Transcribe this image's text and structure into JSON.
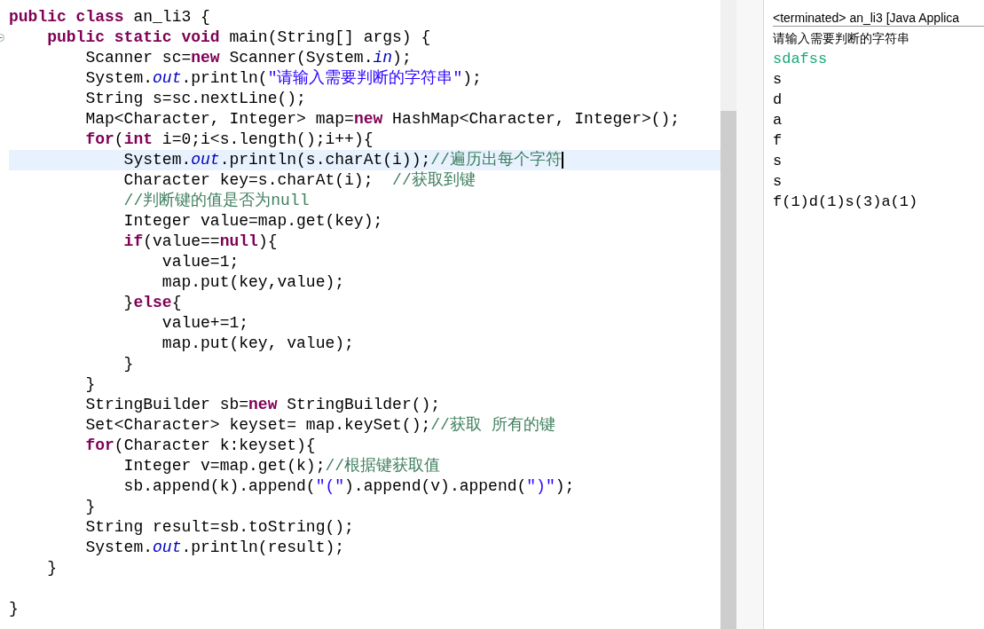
{
  "editor": {
    "lines": [
      {
        "current": false,
        "folded_marker": false,
        "tokens": [
          {
            "kind": "keyword",
            "text": "public class"
          },
          {
            "kind": "plain",
            "text": " an_li3 {"
          }
        ]
      },
      {
        "current": false,
        "folded_marker": true,
        "tokens": [
          {
            "kind": "keyword",
            "text": "    public static void"
          },
          {
            "kind": "plain",
            "text": " main(String[] args) {"
          }
        ]
      },
      {
        "current": false,
        "folded_marker": false,
        "tokens": [
          {
            "kind": "plain",
            "text": "        Scanner sc="
          },
          {
            "kind": "keyword",
            "text": "new"
          },
          {
            "kind": "plain",
            "text": " Scanner(System."
          },
          {
            "kind": "field",
            "text": "in"
          },
          {
            "kind": "plain",
            "text": ");"
          }
        ]
      },
      {
        "current": false,
        "folded_marker": false,
        "tokens": [
          {
            "kind": "plain",
            "text": "        System."
          },
          {
            "kind": "field",
            "text": "out"
          },
          {
            "kind": "plain",
            "text": ".println("
          },
          {
            "kind": "string",
            "text": "\"请输入需要判断的字符串\""
          },
          {
            "kind": "plain",
            "text": ");"
          }
        ]
      },
      {
        "current": false,
        "folded_marker": false,
        "tokens": [
          {
            "kind": "plain",
            "text": "        String s=sc.nextLine();"
          }
        ]
      },
      {
        "current": false,
        "folded_marker": false,
        "tokens": [
          {
            "kind": "plain",
            "text": "        Map<Character, Integer> map="
          },
          {
            "kind": "keyword",
            "text": "new"
          },
          {
            "kind": "plain",
            "text": " HashMap<Character, Integer>();"
          }
        ]
      },
      {
        "current": false,
        "folded_marker": false,
        "tokens": [
          {
            "kind": "keyword",
            "text": "        for"
          },
          {
            "kind": "plain",
            "text": "("
          },
          {
            "kind": "keyword",
            "text": "int"
          },
          {
            "kind": "plain",
            "text": " i=0;i<s.length();i++){"
          }
        ]
      },
      {
        "current": true,
        "folded_marker": false,
        "tokens": [
          {
            "kind": "plain",
            "text": "            System."
          },
          {
            "kind": "field",
            "text": "out"
          },
          {
            "kind": "plain",
            "text": ".println(s.charAt(i));"
          },
          {
            "kind": "comment",
            "text": "//遍历出每个字符"
          }
        ]
      },
      {
        "current": false,
        "folded_marker": false,
        "tokens": [
          {
            "kind": "plain",
            "text": "            Character key=s.charAt(i);  "
          },
          {
            "kind": "comment",
            "text": "//获取到键"
          }
        ]
      },
      {
        "current": false,
        "folded_marker": false,
        "tokens": [
          {
            "kind": "comment",
            "text": "            //判断键的值是否为null"
          }
        ]
      },
      {
        "current": false,
        "folded_marker": false,
        "tokens": [
          {
            "kind": "plain",
            "text": "            Integer value=map.get(key);"
          }
        ]
      },
      {
        "current": false,
        "folded_marker": false,
        "tokens": [
          {
            "kind": "keyword",
            "text": "            if"
          },
          {
            "kind": "plain",
            "text": "(value=="
          },
          {
            "kind": "keyword",
            "text": "null"
          },
          {
            "kind": "plain",
            "text": "){"
          }
        ]
      },
      {
        "current": false,
        "folded_marker": false,
        "tokens": [
          {
            "kind": "plain",
            "text": "                value=1;"
          }
        ]
      },
      {
        "current": false,
        "folded_marker": false,
        "tokens": [
          {
            "kind": "plain",
            "text": "                map.put(key,value);"
          }
        ]
      },
      {
        "current": false,
        "folded_marker": false,
        "tokens": [
          {
            "kind": "plain",
            "text": "            }"
          },
          {
            "kind": "keyword",
            "text": "else"
          },
          {
            "kind": "plain",
            "text": "{"
          }
        ]
      },
      {
        "current": false,
        "folded_marker": false,
        "tokens": [
          {
            "kind": "plain",
            "text": "                value+=1;"
          }
        ]
      },
      {
        "current": false,
        "folded_marker": false,
        "tokens": [
          {
            "kind": "plain",
            "text": "                map.put(key, value);"
          }
        ]
      },
      {
        "current": false,
        "folded_marker": false,
        "tokens": [
          {
            "kind": "plain",
            "text": "            }"
          }
        ]
      },
      {
        "current": false,
        "folded_marker": false,
        "tokens": [
          {
            "kind": "plain",
            "text": "        }"
          }
        ]
      },
      {
        "current": false,
        "folded_marker": false,
        "tokens": [
          {
            "kind": "plain",
            "text": "        StringBuilder sb="
          },
          {
            "kind": "keyword",
            "text": "new"
          },
          {
            "kind": "plain",
            "text": " StringBuilder();"
          }
        ]
      },
      {
        "current": false,
        "folded_marker": false,
        "tokens": [
          {
            "kind": "plain",
            "text": "        Set<Character> keyset= map.keySet();"
          },
          {
            "kind": "comment",
            "text": "//获取 所有的键"
          }
        ]
      },
      {
        "current": false,
        "folded_marker": false,
        "tokens": [
          {
            "kind": "keyword",
            "text": "        for"
          },
          {
            "kind": "plain",
            "text": "(Character k:keyset){"
          }
        ]
      },
      {
        "current": false,
        "folded_marker": false,
        "tokens": [
          {
            "kind": "plain",
            "text": "            Integer v=map.get(k);"
          },
          {
            "kind": "comment",
            "text": "//根据键获取值"
          }
        ]
      },
      {
        "current": false,
        "folded_marker": false,
        "tokens": [
          {
            "kind": "plain",
            "text": "            sb.append(k).append("
          },
          {
            "kind": "string",
            "text": "\"(\""
          },
          {
            "kind": "plain",
            "text": ").append(v).append("
          },
          {
            "kind": "string",
            "text": "\")\""
          },
          {
            "kind": "plain",
            "text": ");"
          }
        ]
      },
      {
        "current": false,
        "folded_marker": false,
        "tokens": [
          {
            "kind": "plain",
            "text": "        }"
          }
        ]
      },
      {
        "current": false,
        "folded_marker": false,
        "tokens": [
          {
            "kind": "plain",
            "text": "        String result=sb.toString();"
          }
        ]
      },
      {
        "current": false,
        "folded_marker": false,
        "tokens": [
          {
            "kind": "plain",
            "text": "        System."
          },
          {
            "kind": "field",
            "text": "out"
          },
          {
            "kind": "plain",
            "text": ".println(result);"
          }
        ]
      },
      {
        "current": false,
        "folded_marker": false,
        "tokens": [
          {
            "kind": "plain",
            "text": "    }"
          }
        ]
      },
      {
        "current": false,
        "folded_marker": false
      },
      {
        "current": false,
        "folded_marker": false,
        "tokens": [
          {
            "kind": "plain",
            "text": "}"
          }
        ]
      }
    ]
  },
  "console": {
    "header": "<terminated> an_li3 [Java Applica",
    "lines": [
      {
        "kind": "prompt",
        "text": "请输入需要判断的字符串"
      },
      {
        "kind": "input",
        "text": "sdafss"
      },
      {
        "kind": "output",
        "text": "s"
      },
      {
        "kind": "output",
        "text": "d"
      },
      {
        "kind": "output",
        "text": "a"
      },
      {
        "kind": "output",
        "text": "f"
      },
      {
        "kind": "output",
        "text": "s"
      },
      {
        "kind": "output",
        "text": "s"
      },
      {
        "kind": "output",
        "text": "f(1)d(1)s(3)a(1)"
      }
    ]
  }
}
